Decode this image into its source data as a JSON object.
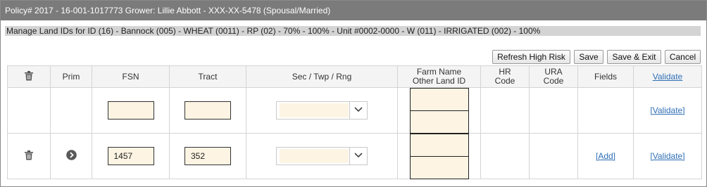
{
  "title": "Policy# 2017 - 16-001-1017773 Grower: Lillie Abbott - XXX-XX-5478 (Spousal/Married)",
  "subtitle": "Manage Land IDs for ID (16) - Bannock (005) - WHEAT (0011) - RP (02) - 70% - 100% - Unit #0002-0000 - W (011) - IRRIGATED (002) - 100%",
  "toolbar": {
    "refresh_label": "Refresh High Risk",
    "save_label": "Save",
    "save_exit_label": "Save & Exit",
    "cancel_label": "Cancel"
  },
  "columns": {
    "delete_icon": "trash-icon",
    "prim": "Prim",
    "fsn": "FSN",
    "tract": "Tract",
    "sec_twp_rng": "Sec / Twp / Rng",
    "farm_name": "Farm Name",
    "other_land_id": "Other Land ID",
    "hr_code_line1": "HR",
    "hr_code_line2": "Code",
    "ura_code_line1": "URA",
    "ura_code_line2": "Code",
    "fields": "Fields",
    "validate": "Validate"
  },
  "rows": [
    {
      "fsn": "",
      "tract": "",
      "sec_twp_rng": "",
      "fields_link": "",
      "validate_link": "[Validate]"
    },
    {
      "delete_icon": "trash-icon",
      "prim_icon": "chevron-right-circle-icon",
      "fsn": "1457",
      "tract": "352",
      "sec_twp_rng": "",
      "fields_link": "[Add]",
      "validate_link": "[Validate]"
    }
  ],
  "colors": {
    "titlebar_bg": "#7b7b7b",
    "subtitle_bg": "#d4d4d4",
    "input_bg": "#fdf4e3",
    "link": "#2f6fb5"
  }
}
